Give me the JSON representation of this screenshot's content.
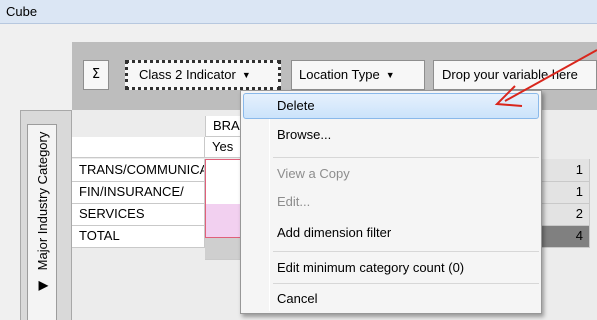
{
  "window": {
    "title": "Cube"
  },
  "toolbar": {
    "sigma_label": "Σ",
    "class_indicator": "Class 2 Indicator",
    "location_type": "Location Type",
    "drop_variable": "Drop your variable here"
  },
  "side_header": {
    "label": "Major Industry Category",
    "arrow_glyph": "◀"
  },
  "grid": {
    "col_header_1": "BRA",
    "col_header_2": "Yes",
    "rows": [
      {
        "label": "TRANS/COMMUNICATION",
        "value": "1"
      },
      {
        "label": "FIN/INSURANCE/",
        "value": "1"
      },
      {
        "label": "SERVICES",
        "value": "2"
      },
      {
        "label": "TOTAL",
        "value": "4"
      }
    ]
  },
  "context_menu": {
    "items": [
      {
        "label": "Delete",
        "state": "highlighted"
      },
      {
        "label": "Browse...",
        "state": "enabled"
      },
      {
        "label": "View a Copy",
        "state": "disabled"
      },
      {
        "label": "Edit...",
        "state": "disabled"
      },
      {
        "label": "Add dimension filter",
        "state": "enabled"
      },
      {
        "label": "Edit minimum category count (0)",
        "state": "enabled"
      },
      {
        "label": "Cancel",
        "state": "enabled"
      }
    ]
  },
  "annotation": {
    "arrow_color": "#d9261c"
  }
}
